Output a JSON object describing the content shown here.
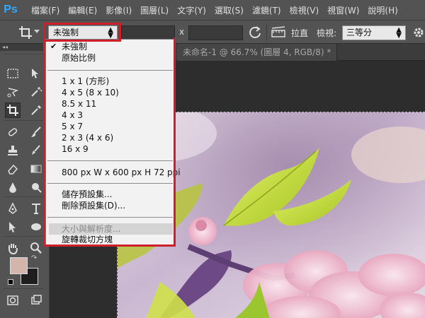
{
  "app": {
    "logo": "Ps"
  },
  "menu": [
    "檔案(F)",
    "編輯(E)",
    "影像(I)",
    "圖層(L)",
    "文字(Y)",
    "選取(S)",
    "濾鏡(T)",
    "檢視(V)",
    "視窗(W)",
    "說明(H)"
  ],
  "options": {
    "ratio_value": "未強制",
    "dimension_separator": "x",
    "straighten_label": "拉直",
    "view_label": "檢視:",
    "view_value": "三等分"
  },
  "document": {
    "tab_title": "未命名-1 @ 66.7% (圖層 4, RGB/8) *"
  },
  "dropdown": {
    "items": [
      {
        "label": "未強制",
        "checked": true
      },
      {
        "label": "原始比例"
      },
      {
        "label": "1 x 1 (方形)"
      },
      {
        "label": "4 x 5 (8 x 10)"
      },
      {
        "label": "8.5 x 11"
      },
      {
        "label": "4 x 3"
      },
      {
        "label": "5 x 7"
      },
      {
        "label": "2 x 3 (4 x 6)"
      },
      {
        "label": "16 x 9"
      },
      {
        "label": "800 px W x 600 px H 72 ppi"
      },
      {
        "label": "儲存預設集..."
      },
      {
        "label": "刪除預設集(D)..."
      },
      {
        "label": "大小與解析度...",
        "disabled": true
      },
      {
        "label": "旋轉裁切方塊"
      }
    ]
  },
  "colors": {
    "foreground": "#d4b5ab",
    "background": "#1e1e1e",
    "highlight": "#cf1f2a",
    "ps_blue": "#31a8ff"
  },
  "icons": [
    "crop-icon",
    "swap-icon",
    "straighten-icon",
    "gear-icon",
    "move-icon",
    "marquee-icon",
    "lasso-icon",
    "magic-wand-icon",
    "eyedropper-icon",
    "brush-icon",
    "pen-icon",
    "type-icon",
    "hand-icon",
    "zoom-icon"
  ]
}
